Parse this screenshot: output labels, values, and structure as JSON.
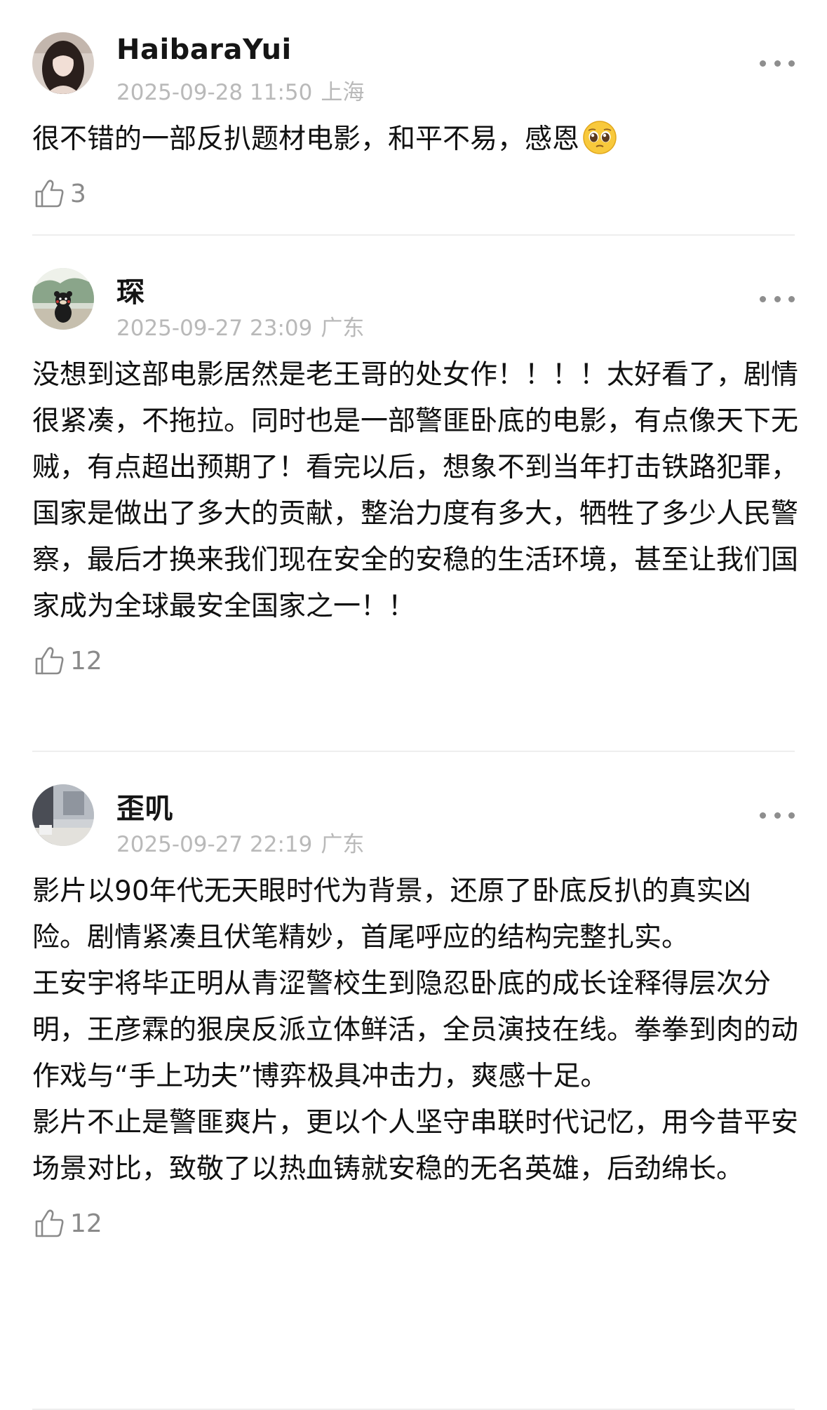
{
  "comments": [
    {
      "username": "HaibaraYui",
      "timestamp": "2025-09-28 11:50",
      "location": "上海",
      "text": "很不错的一部反扒题材电影，和平不易，感恩",
      "emoji": "pleading-face-emoji",
      "likes": "3",
      "avatar": "woman-portrait-avatar"
    },
    {
      "username": "琛",
      "timestamp": "2025-09-27 23:09",
      "location": "广东",
      "text": "没想到这部电影居然是老王哥的处女作！！！！太好看了，剧情很紧凑，不拖拉。同时也是一部警匪卧底的电影，有点像天下无贼，有点超出预期了！看完以后，想象不到当年打击铁路犯罪，国家是做出了多大的贡献，整治力度有多大，牺牲了多少人民警察，最后才换来我们现在安全的安稳的生活环境，甚至让我们国家成为全球最安全国家之一！！",
      "likes": "12",
      "avatar": "bear-mascot-avatar"
    },
    {
      "username": "歪叽",
      "timestamp": "2025-09-27 22:19",
      "location": "广东",
      "text": "影片以90年代无天眼时代为背景，还原了卧底反扒的真实凶险。剧情紧凑且伏笔精妙，首尾呼应的结构完整扎实。\n王安宇将毕正明从青涩警校生到隐忍卧底的成长诠释得层次分明，王彦霖的狠戾反派立体鲜活，全员演技在线。拳拳到肉的动作戏与“手上功夫”博弈极具冲击力，爽感十足。\n影片不止是警匪爽片，更以个人坚守串联时代记忆，用今昔平安场景对比，致敬了以热血铸就安稳的无名英雄，后劲绵长。",
      "likes": "12",
      "avatar": "room-photo-avatar"
    }
  ],
  "colors": {
    "text": "#111111",
    "meta": "#b9b9b9",
    "icon": "#8a8a8a",
    "divider": "#eeeeee"
  }
}
